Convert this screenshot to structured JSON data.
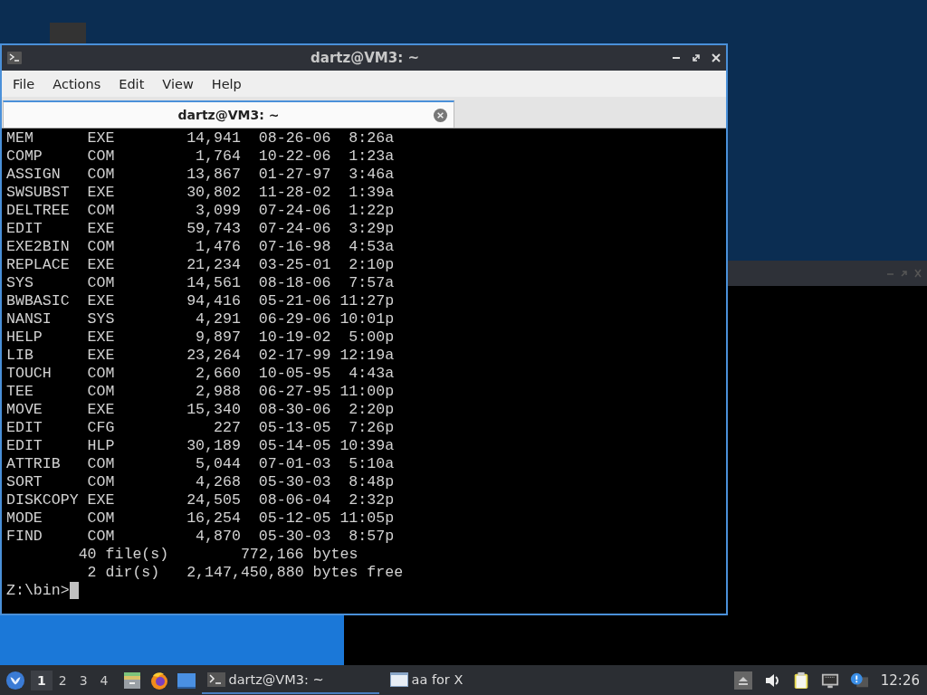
{
  "terminal": {
    "title": "dartz@VM3: ~",
    "menu": [
      "File",
      "Actions",
      "Edit",
      "View",
      "Help"
    ],
    "tabs": [
      {
        "label": "dartz@VM3: ~",
        "selected": true
      }
    ],
    "listing": [
      {
        "name": "MEM",
        "ext": "EXE",
        "size": "14,941",
        "date": "08-26-06",
        "time": "8:26a"
      },
      {
        "name": "COMP",
        "ext": "COM",
        "size": "1,764",
        "date": "10-22-06",
        "time": "1:23a"
      },
      {
        "name": "ASSIGN",
        "ext": "COM",
        "size": "13,867",
        "date": "01-27-97",
        "time": "3:46a"
      },
      {
        "name": "SWSUBST",
        "ext": "EXE",
        "size": "30,802",
        "date": "11-28-02",
        "time": "1:39a"
      },
      {
        "name": "DELTREE",
        "ext": "COM",
        "size": "3,099",
        "date": "07-24-06",
        "time": "1:22p"
      },
      {
        "name": "EDIT",
        "ext": "EXE",
        "size": "59,743",
        "date": "07-24-06",
        "time": "3:29p"
      },
      {
        "name": "EXE2BIN",
        "ext": "COM",
        "size": "1,476",
        "date": "07-16-98",
        "time": "4:53a"
      },
      {
        "name": "REPLACE",
        "ext": "EXE",
        "size": "21,234",
        "date": "03-25-01",
        "time": "2:10p"
      },
      {
        "name": "SYS",
        "ext": "COM",
        "size": "14,561",
        "date": "08-18-06",
        "time": "7:57a"
      },
      {
        "name": "BWBASIC",
        "ext": "EXE",
        "size": "94,416",
        "date": "05-21-06",
        "time": "11:27p"
      },
      {
        "name": "NANSI",
        "ext": "SYS",
        "size": "4,291",
        "date": "06-29-06",
        "time": "10:01p"
      },
      {
        "name": "HELP",
        "ext": "EXE",
        "size": "9,897",
        "date": "10-19-02",
        "time": "5:00p"
      },
      {
        "name": "LIB",
        "ext": "EXE",
        "size": "23,264",
        "date": "02-17-99",
        "time": "12:19a"
      },
      {
        "name": "TOUCH",
        "ext": "COM",
        "size": "2,660",
        "date": "10-05-95",
        "time": "4:43a"
      },
      {
        "name": "TEE",
        "ext": "COM",
        "size": "2,988",
        "date": "06-27-95",
        "time": "11:00p"
      },
      {
        "name": "MOVE",
        "ext": "EXE",
        "size": "15,340",
        "date": "08-30-06",
        "time": "2:20p"
      },
      {
        "name": "EDIT",
        "ext": "CFG",
        "size": "227",
        "date": "05-13-05",
        "time": "7:26p"
      },
      {
        "name": "EDIT",
        "ext": "HLP",
        "size": "30,189",
        "date": "05-14-05",
        "time": "10:39a"
      },
      {
        "name": "ATTRIB",
        "ext": "COM",
        "size": "5,044",
        "date": "07-01-03",
        "time": "5:10a"
      },
      {
        "name": "SORT",
        "ext": "COM",
        "size": "4,268",
        "date": "05-30-03",
        "time": "8:48p"
      },
      {
        "name": "DISKCOPY",
        "ext": "EXE",
        "size": "24,505",
        "date": "08-06-04",
        "time": "2:32p"
      },
      {
        "name": "MODE",
        "ext": "COM",
        "size": "16,254",
        "date": "05-12-05",
        "time": "11:05p"
      },
      {
        "name": "FIND",
        "ext": "COM",
        "size": "4,870",
        "date": "05-30-03",
        "time": "8:57p"
      }
    ],
    "summary": [
      {
        "count": "40",
        "label": "file(s)",
        "amount": "772,166",
        "unit": "bytes"
      },
      {
        "count": "2",
        "label": "dir(s)",
        "amount": "2,147,450,880",
        "unit": "bytes free"
      }
    ],
    "prompt": "Z:\\bin>"
  },
  "taskbar": {
    "workspaces": [
      {
        "label": "1",
        "selected": true
      },
      {
        "label": "2",
        "selected": false
      },
      {
        "label": "3",
        "selected": false
      },
      {
        "label": "4",
        "selected": false
      }
    ],
    "tasks": [
      {
        "kind": "terminal",
        "label": "dartz@VM3: ~",
        "selected": true
      },
      {
        "kind": "window",
        "label": "aa for X",
        "selected": false
      }
    ],
    "clock": "12:26"
  }
}
